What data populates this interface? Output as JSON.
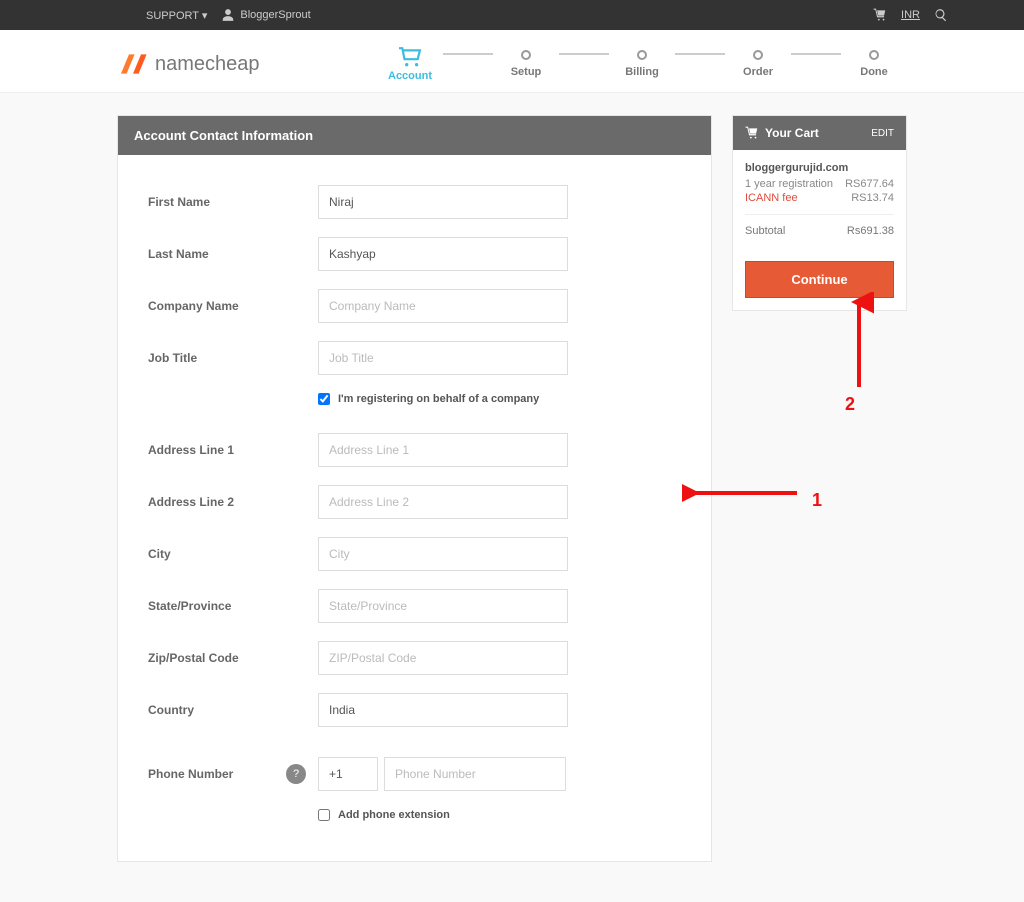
{
  "topbar": {
    "support": "SUPPORT",
    "user": "BloggerSprout",
    "currency": "INR"
  },
  "brand": "namecheap",
  "steps": [
    "Account",
    "Setup",
    "Billing",
    "Order",
    "Done"
  ],
  "section_title": "Account Contact Information",
  "labels": {
    "first_name": "First Name",
    "last_name": "Last Name",
    "company_name": "Company Name",
    "job_title": "Job Title",
    "address1": "Address Line 1",
    "address2": "Address Line 2",
    "city": "City",
    "state": "State/Province",
    "zip": "Zip/Postal Code",
    "country": "Country",
    "phone": "Phone Number"
  },
  "values": {
    "first_name": "Niraj",
    "last_name": "Kashyap",
    "company_name": "",
    "job_title": "",
    "address1": "",
    "address2": "",
    "city": "",
    "state": "",
    "zip": "",
    "country": "India",
    "phone_code": "+1",
    "phone_number": ""
  },
  "placeholders": {
    "company_name": "Company Name",
    "job_title": "Job Title",
    "address1": "Address Line 1",
    "address2": "Address Line 2",
    "city": "City",
    "state": "State/Province",
    "zip": "ZIP/Postal Code",
    "phone": "Phone Number"
  },
  "checkbox_company": "I'm registering on behalf of a company",
  "checkbox_ext": "Add phone extension",
  "cart": {
    "title": "Your Cart",
    "edit": "EDIT",
    "domain": "bloggergurujid.com",
    "reg_label": "1 year registration",
    "reg_price": "RS677.64",
    "icann_label": "ICANN fee",
    "icann_price": "RS13.74",
    "subtotal_label": "Subtotal",
    "subtotal_price": "Rs691.38",
    "continue": "Continue"
  },
  "anno": {
    "one": "1",
    "two": "2"
  }
}
